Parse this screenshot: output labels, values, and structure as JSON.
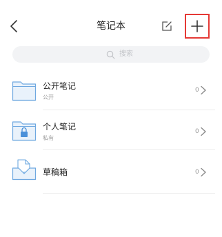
{
  "header": {
    "title": "笔记本",
    "back_icon": "chevron-left-icon",
    "edit_icon": "edit-icon",
    "add_icon": "plus-icon",
    "highlight_color": "#e53935"
  },
  "search": {
    "placeholder": "搜索",
    "icon": "search-icon"
  },
  "notebooks": [
    {
      "name": "公开笔记",
      "sub": "公开",
      "count": "0",
      "icon": "folder-icon"
    },
    {
      "name": "个人笔记",
      "sub": "私有",
      "count": "0",
      "icon": "locked-folder-icon"
    },
    {
      "name": "草稿箱",
      "sub": "",
      "count": "0",
      "icon": "drafts-tray-icon"
    }
  ],
  "colors": {
    "folder_fill": "#e9f2fb",
    "folder_stroke": "#6ea8e0"
  }
}
